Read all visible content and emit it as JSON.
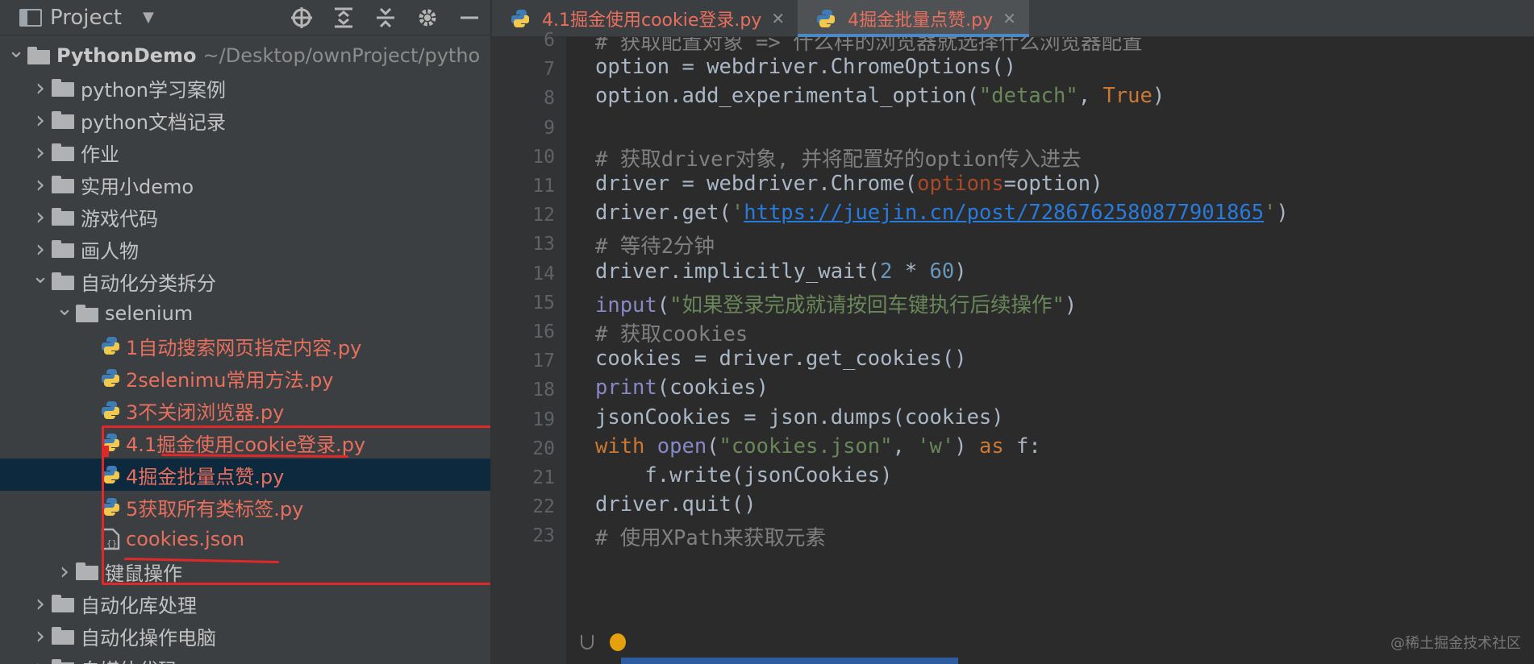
{
  "project_panel": {
    "title": "Project",
    "tree": [
      {
        "name": "tree-root",
        "label": "PythonDemo",
        "hint": "~/Desktop/ownProject/pytho",
        "type": "folder",
        "level": 0,
        "expanded": true
      },
      {
        "name": "tree-folder-python-cases",
        "label": "python学习案例",
        "type": "folder",
        "level": 1,
        "expanded": false
      },
      {
        "name": "tree-folder-python-docs",
        "label": "python文档记录",
        "type": "folder",
        "level": 1,
        "expanded": false
      },
      {
        "name": "tree-folder-homework",
        "label": "作业",
        "type": "folder",
        "level": 1,
        "expanded": false
      },
      {
        "name": "tree-folder-demos",
        "label": "实用小demo",
        "type": "folder",
        "level": 1,
        "expanded": false
      },
      {
        "name": "tree-folder-games",
        "label": "游戏代码",
        "type": "folder",
        "level": 1,
        "expanded": false
      },
      {
        "name": "tree-folder-drawing",
        "label": "画人物",
        "type": "folder",
        "level": 1,
        "expanded": false
      },
      {
        "name": "tree-folder-automation",
        "label": "自动化分类拆分",
        "type": "folder",
        "level": 1,
        "expanded": true
      },
      {
        "name": "tree-folder-selenium",
        "label": "selenium",
        "type": "folder",
        "level": 2,
        "expanded": true
      },
      {
        "name": "tree-file-1",
        "label": "1自动搜索网页指定内容.py",
        "type": "py",
        "level": 3
      },
      {
        "name": "tree-file-2",
        "label": "2selenimu常用方法.py",
        "type": "py",
        "level": 3
      },
      {
        "name": "tree-file-3",
        "label": "3不关闭浏览器.py",
        "type": "py",
        "level": 3
      },
      {
        "name": "tree-file-4-1",
        "label": "4.1掘金使用cookie登录.py",
        "type": "py",
        "level": 3
      },
      {
        "name": "tree-file-4",
        "label": "4掘金批量点赞.py",
        "type": "py",
        "level": 3,
        "selected": true
      },
      {
        "name": "tree-file-5",
        "label": "5获取所有类标签.py",
        "type": "py",
        "level": 3
      },
      {
        "name": "tree-file-cookies-json",
        "label": "cookies.json",
        "type": "json",
        "level": 3
      },
      {
        "name": "tree-folder-keyboard-mouse",
        "label": "键鼠操作",
        "type": "folder",
        "level": 2,
        "expanded": false
      },
      {
        "name": "tree-folder-auto-lib",
        "label": "自动化库处理",
        "type": "folder",
        "level": 1,
        "expanded": false
      },
      {
        "name": "tree-folder-auto-pc",
        "label": "自动化操作电脑",
        "type": "folder",
        "level": 1,
        "expanded": false
      },
      {
        "name": "tree-folder-media",
        "label": "自媒体代码",
        "type": "folder",
        "level": 1,
        "expanded": false
      }
    ]
  },
  "tabs": [
    {
      "label": "4.1掘金使用cookie登录.py",
      "active": false
    },
    {
      "label": "4掘金批量点赞.py",
      "active": true
    }
  ],
  "code": {
    "lines": [
      {
        "n": "6",
        "tokens": [
          [
            "c-com",
            "# 获取配置对象 => 什么样的浏览器就选择什么浏览器配置"
          ]
        ]
      },
      {
        "n": "7",
        "tokens": [
          [
            "",
            "option = webdriver.ChromeOptions()"
          ]
        ]
      },
      {
        "n": "8",
        "tokens": [
          [
            "",
            "option.add_experimental_option("
          ],
          [
            "c-str",
            "\"detach\""
          ],
          [
            "",
            ", "
          ],
          [
            "c-kw",
            "True"
          ],
          [
            "",
            ")"
          ]
        ]
      },
      {
        "n": "9",
        "tokens": []
      },
      {
        "n": "10",
        "tokens": [
          [
            "c-com",
            "# 获取driver对象, 并将配置好的option传入进去"
          ]
        ]
      },
      {
        "n": "11",
        "tokens": [
          [
            "",
            "driver = webdriver.Chrome("
          ],
          [
            "c-param",
            "options"
          ],
          [
            "",
            "=option)"
          ]
        ]
      },
      {
        "n": "12",
        "tokens": [
          [
            "",
            "driver.get("
          ],
          [
            "c-url-str",
            "'"
          ],
          [
            "c-url",
            "https://juejin.cn/post/7286762580877901865"
          ],
          [
            "c-url-str",
            "'"
          ],
          [
            "",
            ")"
          ]
        ]
      },
      {
        "n": "13",
        "tokens": [
          [
            "c-com",
            "# 等待2分钟"
          ]
        ]
      },
      {
        "n": "14",
        "tokens": [
          [
            "",
            "driver.implicitly_wait("
          ],
          [
            "c-num",
            "2"
          ],
          [
            "",
            " * "
          ],
          [
            "c-num",
            "60"
          ],
          [
            "",
            ")"
          ]
        ]
      },
      {
        "n": "15",
        "tokens": [
          [
            "c-bi",
            "input"
          ],
          [
            "",
            "("
          ],
          [
            "c-str",
            "\"如果登录完成就请按回车键执行后续操作\""
          ],
          [
            "",
            ")"
          ]
        ]
      },
      {
        "n": "16",
        "tokens": [
          [
            "c-com",
            "# 获取cookies"
          ]
        ]
      },
      {
        "n": "17",
        "tokens": [
          [
            "",
            "cookies = driver.get_cookies()"
          ]
        ]
      },
      {
        "n": "18",
        "tokens": [
          [
            "c-bi",
            "print"
          ],
          [
            "",
            "(cookies)"
          ]
        ]
      },
      {
        "n": "19",
        "tokens": [
          [
            "",
            "jsonCookies = json.dumps(cookies)"
          ]
        ]
      },
      {
        "n": "20",
        "tokens": [
          [
            "c-kw",
            "with "
          ],
          [
            "c-bi",
            "open"
          ],
          [
            "",
            "("
          ],
          [
            "c-str",
            "\"cookies.json\""
          ],
          [
            "",
            ", "
          ],
          [
            "c-str",
            "'w'"
          ],
          [
            "",
            ") "
          ],
          [
            "c-kw",
            "as"
          ],
          [
            "",
            " f:"
          ]
        ]
      },
      {
        "n": "21",
        "tokens": [
          [
            "",
            "    f.write(jsonCookies)"
          ]
        ]
      },
      {
        "n": "22",
        "tokens": [
          [
            "",
            "driver.quit()"
          ]
        ]
      },
      {
        "n": "23",
        "tokens": [
          [
            "c-com",
            "# 使用XPath来获取元素"
          ]
        ]
      }
    ]
  },
  "watermark": "@稀土掘金技术社区",
  "colors": {
    "file_modified": "#e86f5d",
    "selection": "#0d293e",
    "annotation_red": "#e0282a",
    "tab_accent": "#4a88c7"
  }
}
